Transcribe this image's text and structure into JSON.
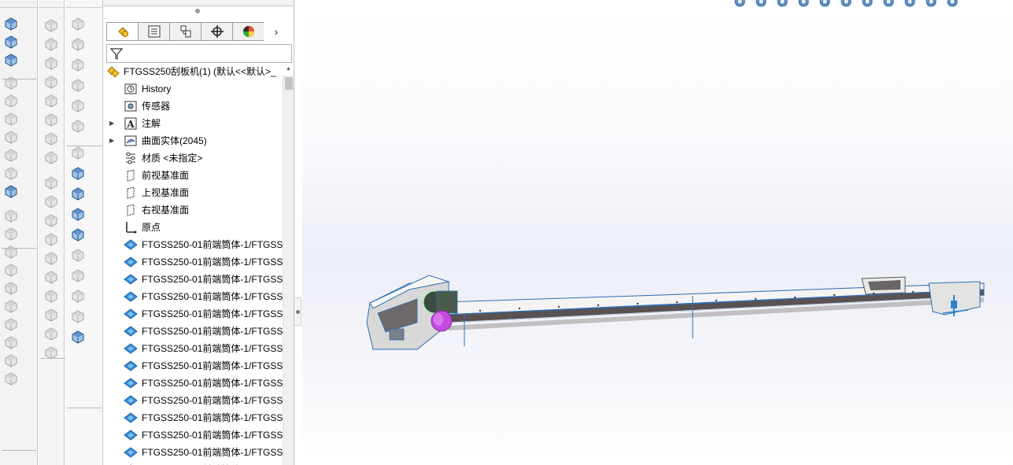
{
  "colors": {
    "accent_blue": "#3a8fd8",
    "part_blue": "#2f7fcf",
    "conveyor_body": "#5a5152",
    "conveyor_light": "#f3f3f3",
    "motor_purple": "#c54be0"
  },
  "left_toolbar": {
    "column1_icons": [
      "extruded-boss-icon",
      "revolved-boss-icon",
      "swept-boss-icon",
      "extruded-cut-icon",
      "hole-wizard-icon",
      "revolved-cut-icon",
      "swept-cut-icon",
      "lofted-cut-icon",
      "boundary-cut-icon",
      "fillet-icon",
      "rib-icon",
      "shell-icon",
      "draft-icon",
      "wrap-icon",
      "intersect-icon",
      "mirror-icon",
      "pattern-icon",
      "reference-geometry-icon",
      "curves-icon",
      "instant3d-icon"
    ],
    "column2_icons": [
      "sketch-icon",
      "smart-dimension-icon",
      "line-icon",
      "rectangle-icon",
      "circle-icon",
      "arc-icon",
      "trim-icon",
      "convert-entities-icon",
      "offset-icon",
      "mirror-entities-icon",
      "linear-pattern-icon",
      "move-entities-icon",
      "relations-icon",
      "repair-sketch-icon",
      "quick-snaps-icon",
      "rapid-sketch-icon",
      "instant2d-icon",
      "shaded-sketch-icon"
    ],
    "column3_icons": [
      "insert-components-icon",
      "mate-icon",
      "component-pattern-icon",
      "smart-fasteners-icon",
      "move-component-icon",
      "show-hidden-icon",
      "assembly-features-icon",
      "reference-geometry-icon",
      "new-motion-study-icon",
      "bill-of-materials-icon",
      "exploded-view-icon",
      "explode-line-sketch-icon",
      "interference-detection-icon",
      "clearance-verification-icon",
      "hole-alignment-icon",
      "measure-icon"
    ]
  },
  "feature_manager": {
    "tabs": [
      "featuremanager-icon",
      "propertymanager-icon",
      "configurationmanager-icon",
      "dimxpert-icon",
      "display-manager-icon"
    ],
    "tabs_more": "›",
    "filter_icon": "filter-icon",
    "root": {
      "label": "FTGSS250刮板机(1)  (默认<<默认>_",
      "icon": "assembly-icon"
    },
    "items": [
      {
        "label": "History",
        "icon": "history-icon",
        "expandable": false
      },
      {
        "label": "传感器",
        "icon": "sensors-icon",
        "expandable": false
      },
      {
        "label": "注解",
        "icon": "annotations-icon",
        "expandable": true
      },
      {
        "label": "曲面实体(2045)",
        "icon": "surface-bodies-icon",
        "expandable": true
      },
      {
        "label": "材质 <未指定>",
        "icon": "material-icon",
        "expandable": false
      },
      {
        "label": "前视基准面",
        "icon": "plane-icon",
        "expandable": false
      },
      {
        "label": "上视基准面",
        "icon": "plane-icon",
        "expandable": false
      },
      {
        "label": "右视基准面",
        "icon": "plane-icon",
        "expandable": false
      },
      {
        "label": "原点",
        "icon": "origin-icon",
        "expandable": false
      },
      {
        "label": "FTGSS250-01前端筒体-1/FTGSS",
        "icon": "imported-part-icon",
        "expandable": false
      },
      {
        "label": "FTGSS250-01前端筒体-1/FTGSS",
        "icon": "imported-part-icon",
        "expandable": false
      },
      {
        "label": "FTGSS250-01前端筒体-1/FTGSS",
        "icon": "imported-part-icon",
        "expandable": false
      },
      {
        "label": "FTGSS250-01前端筒体-1/FTGSS",
        "icon": "imported-part-icon",
        "expandable": false
      },
      {
        "label": "FTGSS250-01前端筒体-1/FTGSS",
        "icon": "imported-part-icon",
        "expandable": false
      },
      {
        "label": "FTGSS250-01前端筒体-1/FTGSS",
        "icon": "imported-part-icon",
        "expandable": false
      },
      {
        "label": "FTGSS250-01前端筒体-1/FTGSS",
        "icon": "imported-part-icon",
        "expandable": false
      },
      {
        "label": "FTGSS250-01前端筒体-1/FTGSS",
        "icon": "imported-part-icon",
        "expandable": false
      },
      {
        "label": "FTGSS250-01前端筒体-1/FTGSS",
        "icon": "imported-part-icon",
        "expandable": false
      },
      {
        "label": "FTGSS250-01前端筒体-1/FTGSS",
        "icon": "imported-part-icon",
        "expandable": false
      },
      {
        "label": "FTGSS250-01前端筒体-1/FTGSS",
        "icon": "imported-part-icon",
        "expandable": false
      },
      {
        "label": "FTGSS250-01前端筒体-1/FTGSS",
        "icon": "imported-part-icon",
        "expandable": false
      },
      {
        "label": "FTGSS250-01前端筒体-1/FTGSS",
        "icon": "imported-part-icon",
        "expandable": false
      },
      {
        "label": "FTGSS250-01前端筒体-1/FTGSS",
        "icon": "imported-part-icon",
        "expandable": false
      }
    ]
  },
  "heads_up_toolbar": [
    "zoom-to-fit-icon",
    "zoom-to-area-icon",
    "previous-view-icon",
    "section-view-icon",
    "dynamic-annotation-views-icon",
    "view-orientation-icon",
    "display-style-icon",
    "hide-show-items-icon",
    "edit-appearance-icon",
    "apply-scene-icon",
    "view-settings-icon"
  ],
  "model": {
    "name": "scraper-conveyor-model"
  }
}
